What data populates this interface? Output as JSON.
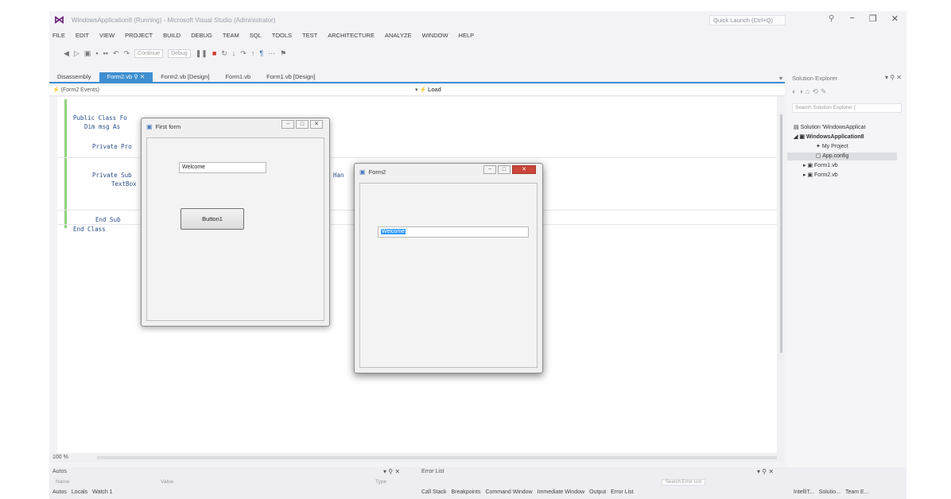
{
  "window": {
    "title": "WindowsApplication8 (Running) - Microsoft Visual Studio (Administrator)",
    "quick_launch": "Quick Launch (Ctrl+Q)"
  },
  "menu": [
    "FILE",
    "EDIT",
    "VIEW",
    "PROJECT",
    "BUILD",
    "DEBUG",
    "TEAM",
    "SQL",
    "TOOLS",
    "TEST",
    "ARCHITECTURE",
    "ANALYZE",
    "WINDOW",
    "HELP"
  ],
  "toolbar": {
    "continue_label": "Continue",
    "config": "Debug"
  },
  "doc_tabs": [
    {
      "label": "Disassembly",
      "active": false
    },
    {
      "label": "Form2.vb",
      "active": true
    },
    {
      "label": "Form2.vb [Design]",
      "active": false
    },
    {
      "label": "Form1.vb",
      "active": false
    },
    {
      "label": "Form1.vb [Design]",
      "active": false
    }
  ],
  "nav": {
    "left": "(Form2 Events)",
    "right": "Load"
  },
  "code": {
    "l1": "Public Class Fo",
    "l2": "Dim msg As",
    "l3": "Private Pro",
    "l4": "Private Sub",
    "l5": "TextBox",
    "l6": ") Han",
    "l7": "End Sub",
    "l8": "End Class"
  },
  "zoom": "100 %",
  "solution_explorer": {
    "title": "Solution Explorer",
    "search_placeholder": "Search Solution Explorer (",
    "items": [
      "Solution 'WindowsApplicat",
      "WindowsApplication8",
      "My Project",
      "App.config",
      "Form1.vb",
      "Form2.vb"
    ]
  },
  "form1": {
    "title": "First form",
    "textbox": "Welcome",
    "button": "Button1"
  },
  "form2": {
    "title": "Form2",
    "textbox": "Welcome"
  },
  "bottom": {
    "autos_title": "Autos",
    "autos_cols": [
      "Name",
      "Value",
      "Type"
    ],
    "autos_tabs": [
      "Autos",
      "Locals",
      "Watch 1"
    ],
    "error_title": "Error List",
    "error_search": "Search Error List",
    "error_tabs": [
      "Call Stack",
      "Breakpoints",
      "Command Window",
      "Immediate Window",
      "Output",
      "Error List"
    ],
    "se_tabs": [
      "IntelliT...",
      "Solutio...",
      "Team E..."
    ]
  }
}
